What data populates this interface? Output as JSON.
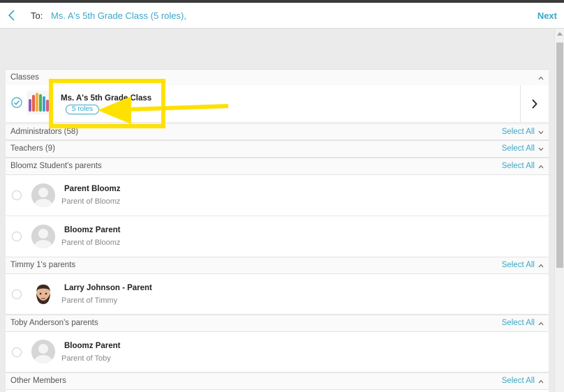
{
  "header": {
    "to_label": "To:",
    "recipients": "Ms. A's 5th Grade Class (5 roles),",
    "next_label": "Next"
  },
  "classes": {
    "title": "Classes",
    "item": {
      "name": "Ms. A's 5th Grade Class",
      "roles": "5 roles"
    }
  },
  "groups": [
    {
      "title": "Administrators (58)",
      "select_all": "Select All"
    },
    {
      "title": "Teachers (9)",
      "select_all": "Select All"
    },
    {
      "title": "Bloomz Student's parents",
      "select_all": "Select All"
    },
    {
      "title": "Timmy 1's parents",
      "select_all": "Select All"
    },
    {
      "title": "Toby Anderson's parents",
      "select_all": "Select All"
    },
    {
      "title": "Other Members",
      "select_all": "Select All"
    }
  ],
  "members": [
    {
      "name": "Parent Bloomz",
      "relation": "Parent of Bloomz"
    },
    {
      "name": "Bloomz Parent",
      "relation": "Parent of Bloomz"
    },
    {
      "name": "Larry Johnson - Parent",
      "relation": "Parent of Timmy"
    },
    {
      "name": "Bloomz Parent",
      "relation": "Parent of Toby"
    }
  ],
  "colors": {
    "accent": "#3aa6c7",
    "highlight": "#ffe100"
  }
}
